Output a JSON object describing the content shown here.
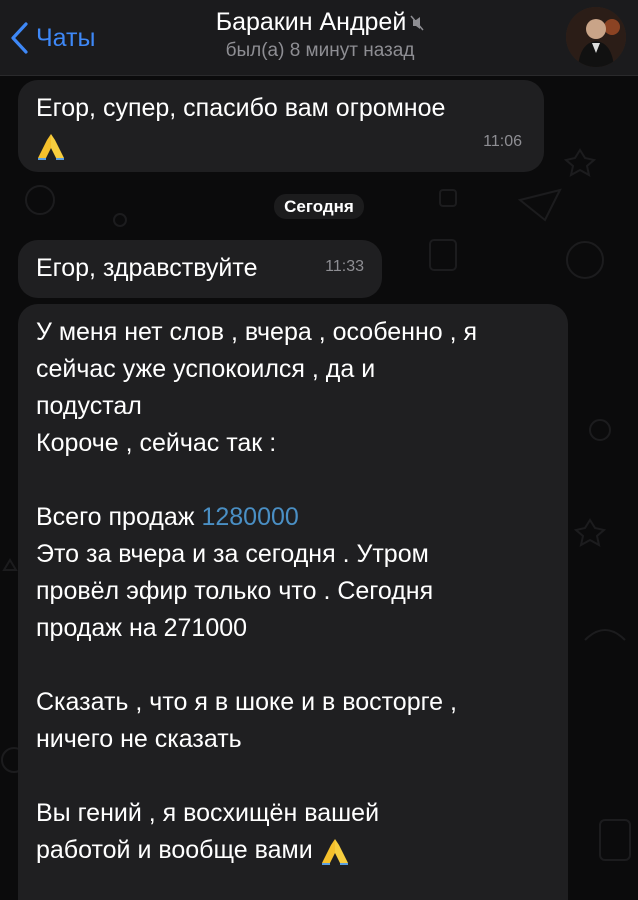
{
  "header": {
    "back_label": "Чаты",
    "title": "Баракин Андрей",
    "status": "был(а) 8 минут назад"
  },
  "colors": {
    "accent": "#3e88f7",
    "background": "#0b0b0c",
    "bubble": "#1f1f21",
    "link": "#4a8fc4"
  },
  "messages": [
    {
      "text": "Егор, супер, спасибо вам огромное",
      "emoji": "folded-hands",
      "time": "11:06"
    },
    {
      "text": "Егор, здравствуйте",
      "time": "11:33"
    },
    {
      "lines": [
        "У меня нет слов , вчера , особенно , я",
        "сейчас уже успокоился , да и",
        "подустал",
        "Короче , сейчас так :",
        "",
        "Всего продаж",
        "Это за вчера и за сегодня . Утром",
        "провёл эфир только что . Сегодня",
        "продаж на 271000",
        "",
        "Сказать , что я в шоке и в восторге ,",
        "ничего не сказать",
        "",
        "Вы гений , я восхищён вашей",
        "работой и вообще вами"
      ],
      "highlight_number": "1280000",
      "emoji": "folded-hands"
    }
  ],
  "date_separator": "Сегодня"
}
